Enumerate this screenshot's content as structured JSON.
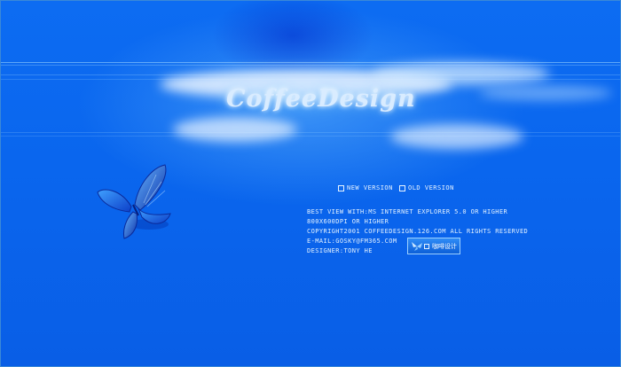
{
  "title": "CoffeeDesign",
  "nav": {
    "new_version": "NEW VERSION",
    "old_version": "OLD VERSION"
  },
  "info_lines": [
    "BEST VIEW WITH:MS INTERNET EXPLORER 5.0 OR HIGHER",
    "800x600dpi or higher",
    "copyright2001 coffeedesign.126.com all rights reserved",
    "E-mail:gosky@fm365.com",
    "designer:tony he"
  ],
  "cn_button": {
    "label": "咖啡设计"
  },
  "colors": {
    "background": "#0a63ea",
    "title_glow": "#8fd3ff",
    "text": "#e2f1ff"
  },
  "icons": {
    "butterfly": "butterfly-icon",
    "checkbox": "checkbox-icon"
  }
}
